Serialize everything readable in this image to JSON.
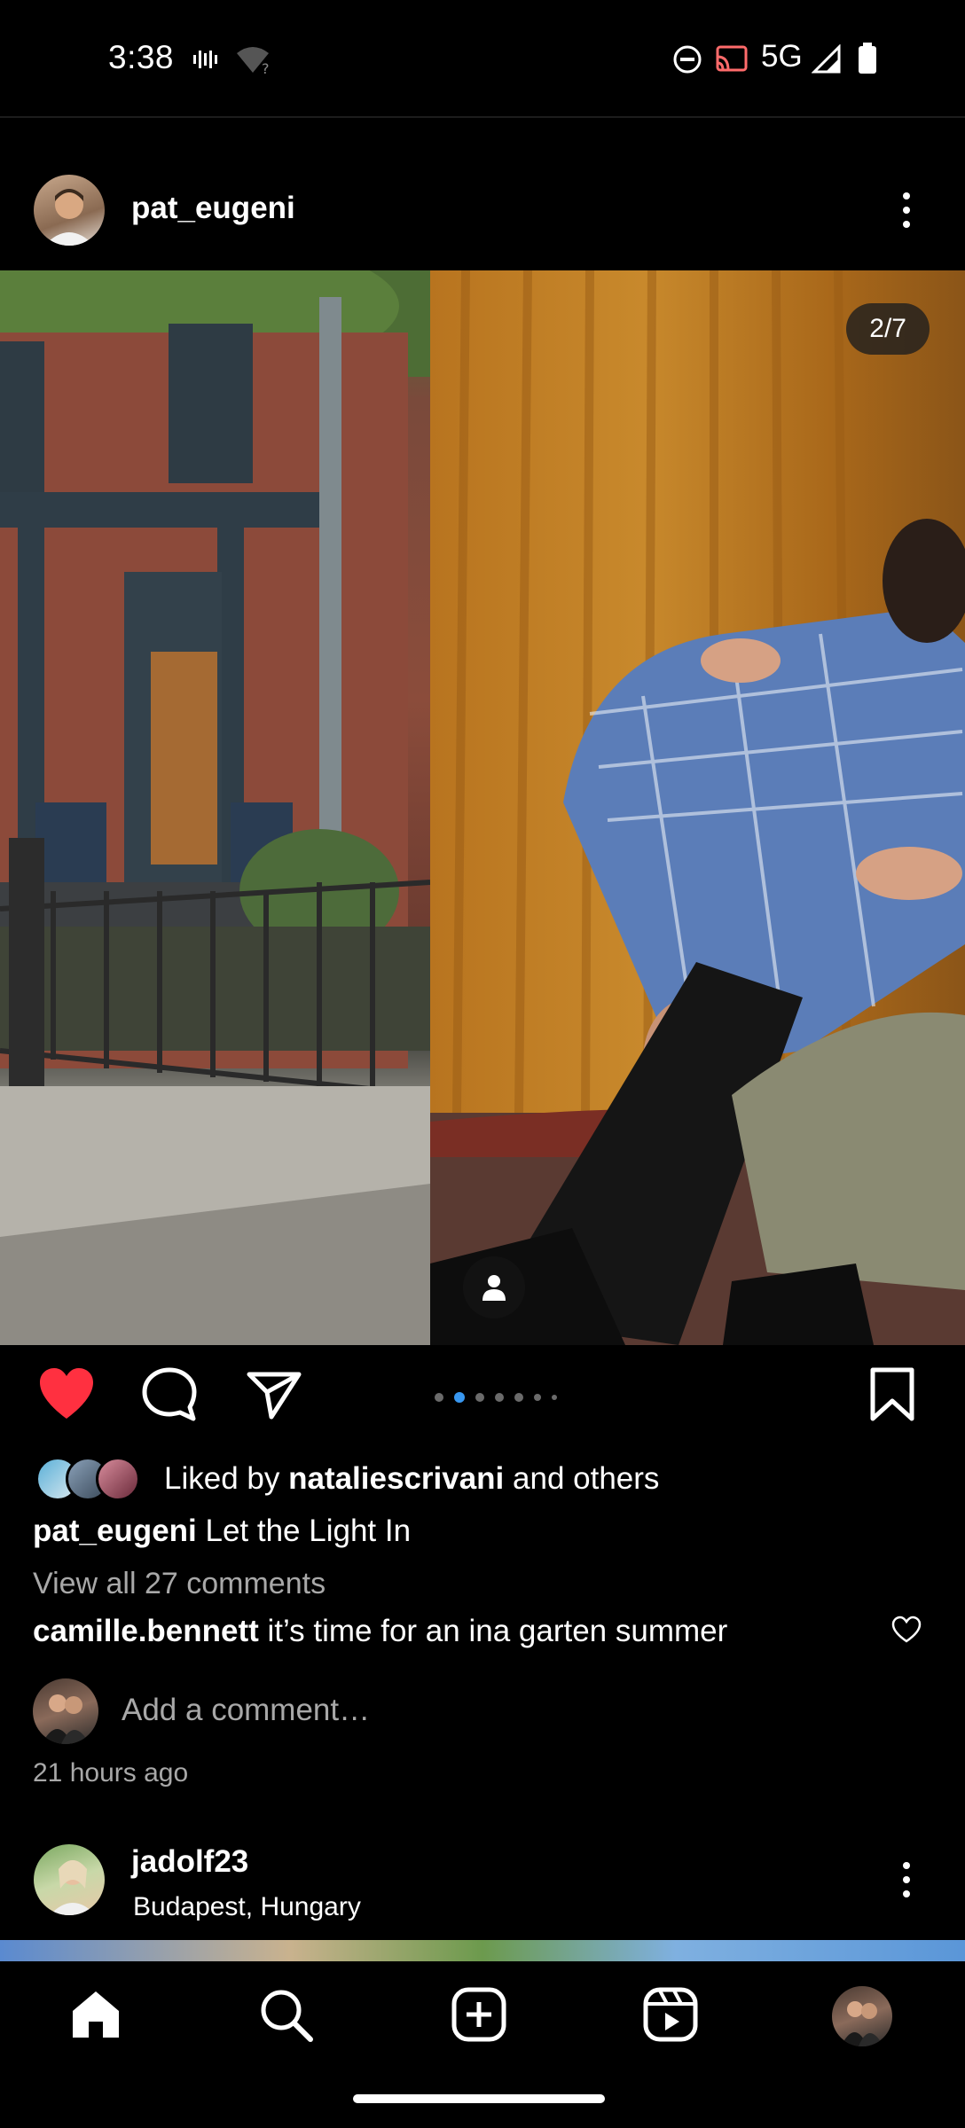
{
  "status_bar": {
    "time": "3:38",
    "network": "5G"
  },
  "post": {
    "username": "pat_eugeni",
    "media_counter": "2/7",
    "carousel": {
      "total": 7,
      "active_index": 1
    },
    "liked_by_prefix": "Liked by ",
    "liked_by_user": "nataliescrivani",
    "liked_by_suffix": " and others",
    "caption_user": "pat_eugeni",
    "caption_text": " Let the Light In",
    "view_comments": "View all 27 comments",
    "top_comment_user": "camille.bennett",
    "top_comment_text": " it’s time for an ina garten summer",
    "add_comment_placeholder": "Add a comment…",
    "timestamp": "21 hours ago",
    "liked": true
  },
  "next_post": {
    "username": "jadolf23",
    "location": "Budapest, Hungary"
  },
  "icons": {
    "like": "heart-icon",
    "comment": "comment-icon",
    "share": "send-icon",
    "save": "bookmark-icon",
    "nav": [
      "home-icon",
      "search-icon",
      "create-icon",
      "reels-icon",
      "profile-avatar"
    ]
  },
  "colors": {
    "like_red": "#ff3040",
    "dot_active": "#3897f0",
    "secondary_text": "#a8a8a8"
  }
}
